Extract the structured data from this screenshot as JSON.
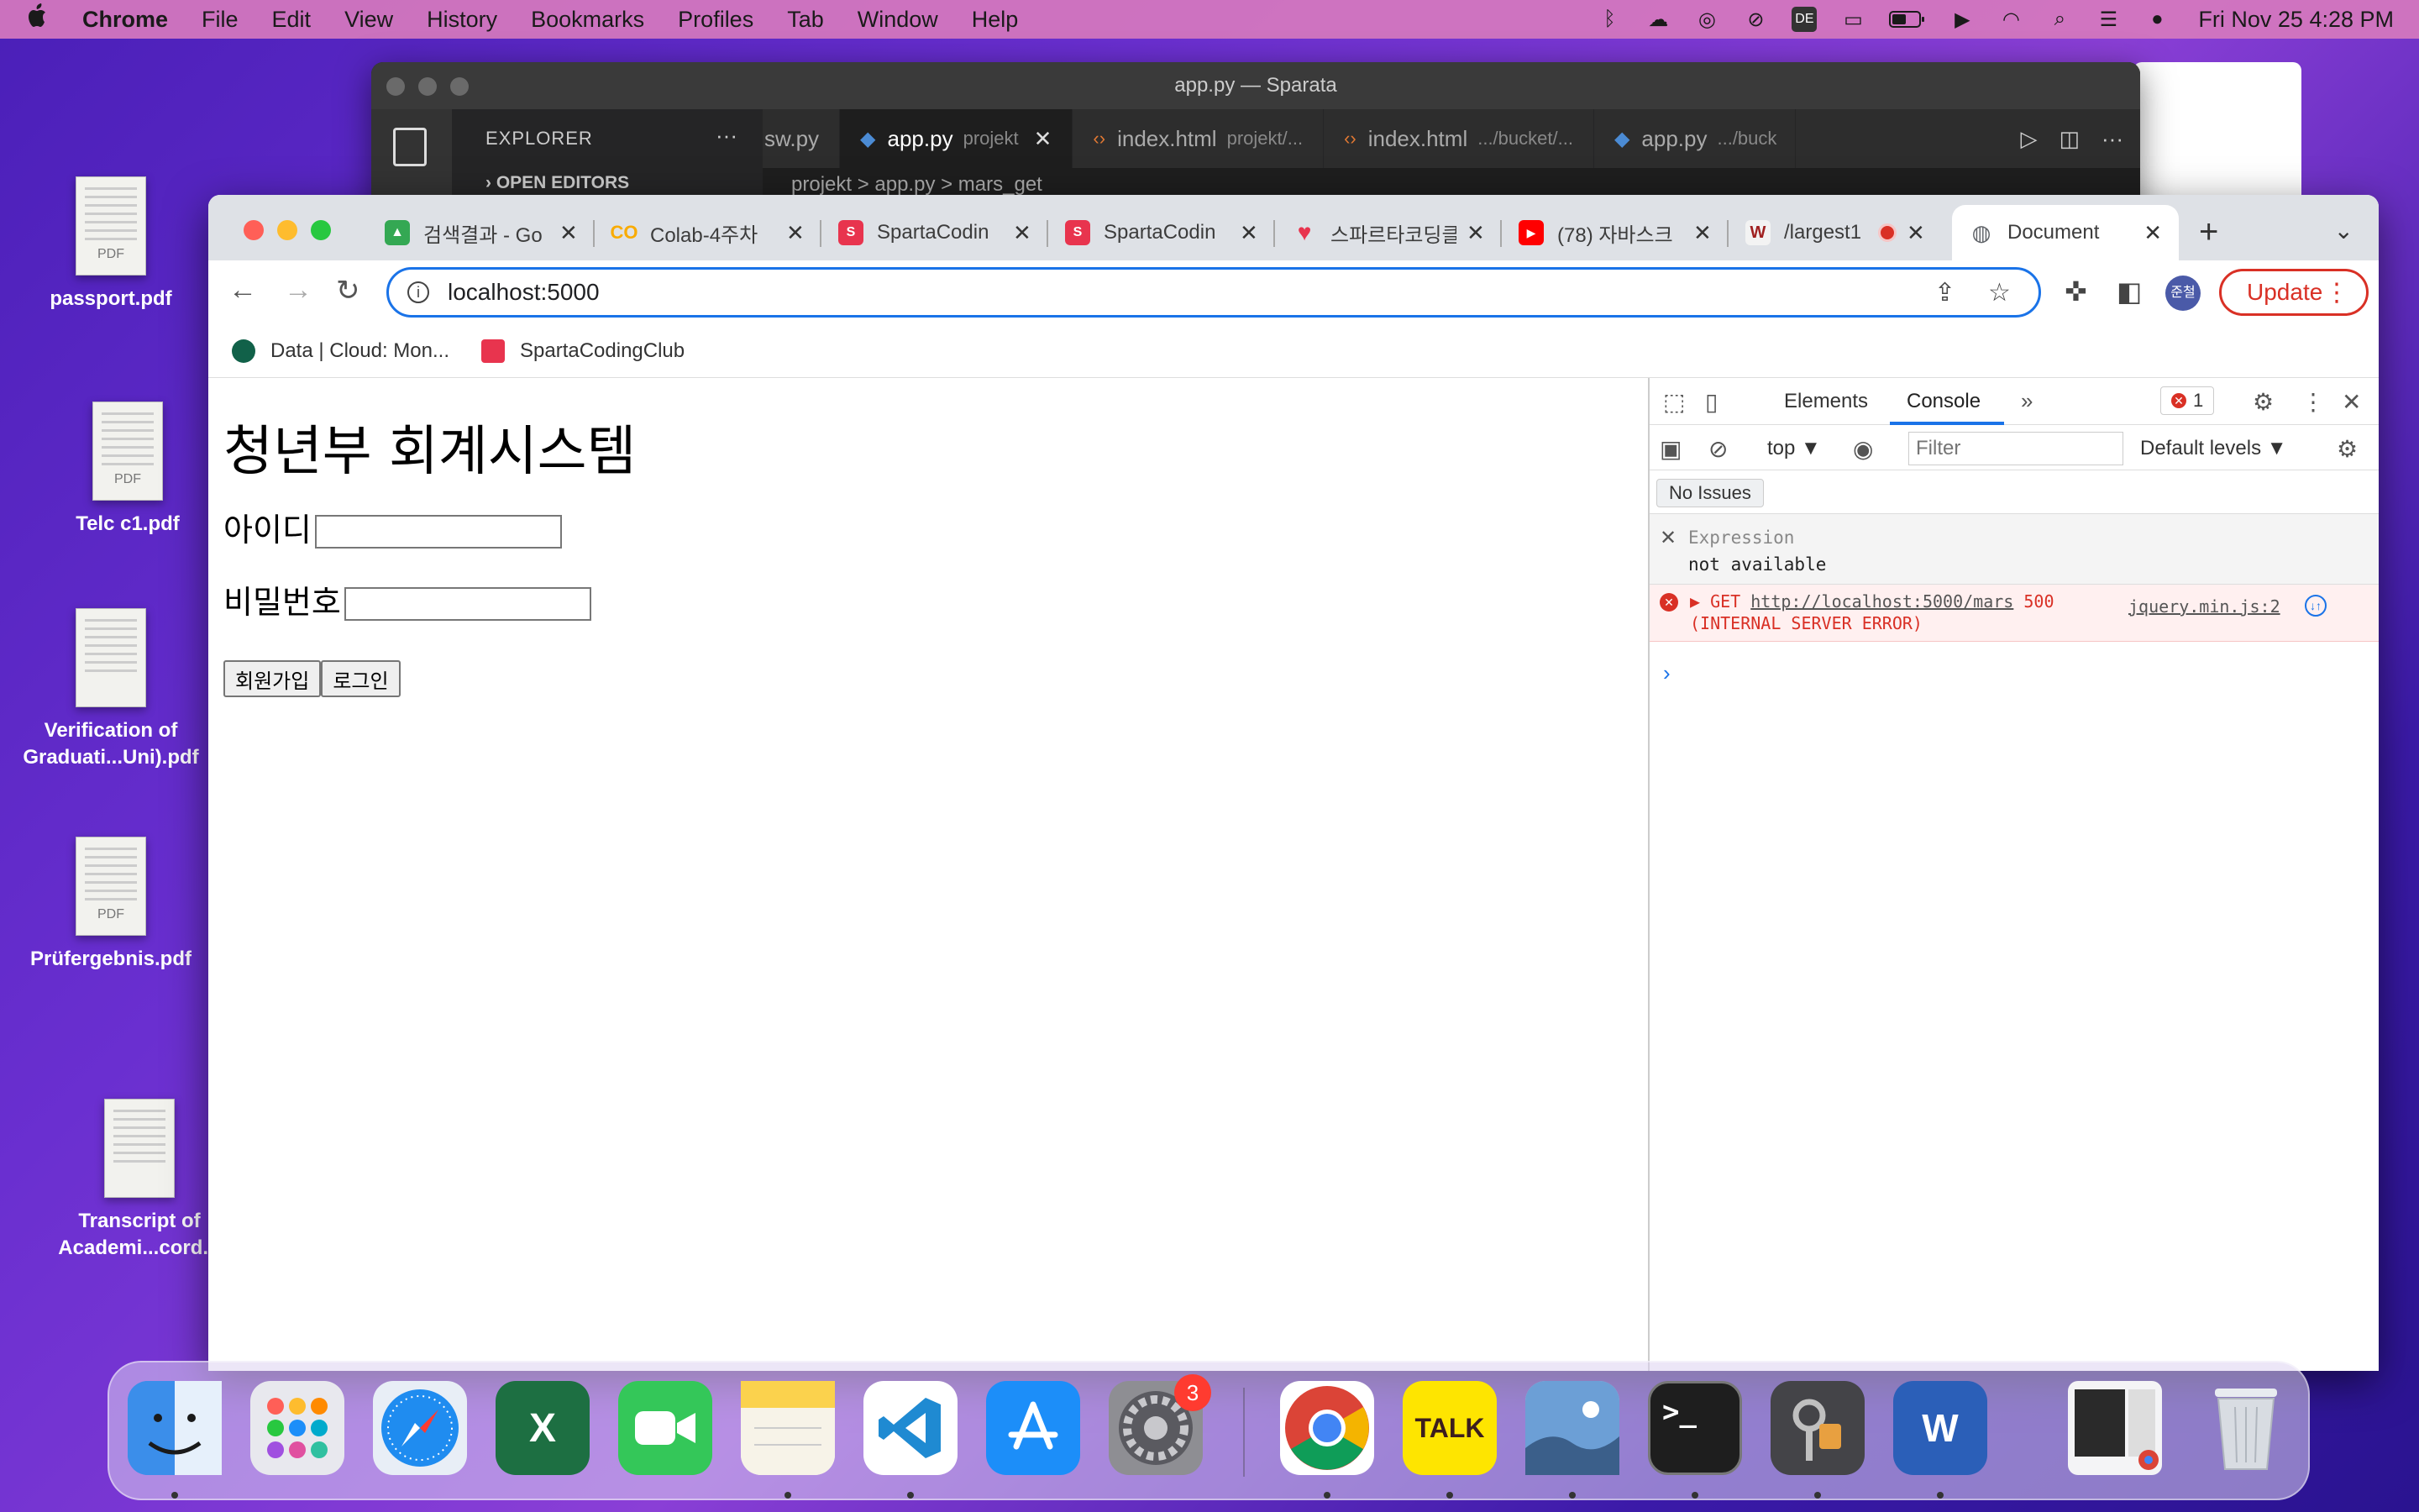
{
  "menubar": {
    "apple": "",
    "items": [
      "Chrome",
      "File",
      "Edit",
      "View",
      "History",
      "Bookmarks",
      "Profiles",
      "Tab",
      "Window",
      "Help"
    ],
    "status_icons": [
      "bluetooth-icon",
      "creative-cloud-icon",
      "airdrop-icon",
      "mute-icon",
      "keyboard-de-icon",
      "display-icon",
      "battery-icon",
      "play-icon",
      "wifi-icon",
      "spotlight-icon",
      "control-center-icon",
      "siri-icon"
    ],
    "keyboard_label": "DE",
    "clock": "Fri Nov 25  4:28 PM"
  },
  "desktop": {
    "files": [
      {
        "name": "passport.pdf",
        "tag": "PDF"
      },
      {
        "name": "Telc c1.pdf",
        "tag": "PDF"
      },
      {
        "name": "Verification of Graduati...Uni).pdf",
        "tag": ""
      },
      {
        "name": "Prüfergebnis.pdf",
        "tag": "PDF"
      },
      {
        "name": "Transcript of Academi...cord.p",
        "tag": ""
      }
    ]
  },
  "vscode": {
    "title": "app.py — Sparata",
    "explorer_title": "EXPLORER",
    "explorer_more": "···",
    "open_editors": "OPEN EDITORS",
    "tabs": [
      {
        "label": "sw.py",
        "sub": "",
        "kind": "py",
        "active": false
      },
      {
        "label": "app.py",
        "sub": "projekt",
        "kind": "py",
        "active": true
      },
      {
        "label": "index.html",
        "sub": "projekt/...",
        "kind": "html",
        "active": false
      },
      {
        "label": "index.html",
        "sub": ".../bucket/...",
        "kind": "html",
        "active": false
      },
      {
        "label": "app.py",
        "sub": ".../buck",
        "kind": "py",
        "active": false
      }
    ],
    "breadcrumb": "projekt  >  app.py  >  mars_get"
  },
  "chrome": {
    "tabs": [
      {
        "title": "검색결과 - Go",
        "icon": "google-drive-icon",
        "color": "#34a853"
      },
      {
        "title": "Colab-4주차",
        "icon": "colab-icon",
        "color": "#f9ab00"
      },
      {
        "title": "SpartaCodin",
        "icon": "sparta-icon",
        "color": "#e8344e"
      },
      {
        "title": "SpartaCodin",
        "icon": "sparta-icon",
        "color": "#e8344e"
      },
      {
        "title": "스파르타코딩클",
        "icon": "heart-icon",
        "color": "#e8344e"
      },
      {
        "title": "(78) 자바스크",
        "icon": "youtube-icon",
        "color": "#ff0000"
      },
      {
        "title": "/largest1",
        "icon": "wiki-icon",
        "color": "#a02020"
      },
      {
        "title": "Document",
        "icon": "globe-icon",
        "color": "#5f6368"
      }
    ],
    "new_tab": "+",
    "url": "localhost:5000",
    "update_label": "Update",
    "avatar_text": "준철",
    "bookmarks": [
      {
        "label": "Data | Cloud: Mon...",
        "color": "#116149"
      },
      {
        "label": "SpartaCodingClub",
        "color": "#e8344e"
      }
    ]
  },
  "page": {
    "heading": "청년부 회계시스템",
    "id_label": "아이디",
    "pw_label": "비밀번호",
    "signup_button": "회원가입",
    "login_button": "로그인"
  },
  "devtools": {
    "tabs": [
      "Elements",
      "Console"
    ],
    "active_tab": "Console",
    "more": "»",
    "error_count": "1",
    "context": "top ▼",
    "filter_placeholder": "Filter",
    "levels": "Default levels ▼",
    "issues": "No Issues",
    "expression_label": "Expression",
    "expression_value": "not available",
    "error": {
      "method": "▶ GET",
      "url": "http://localhost:5000/mars",
      "status": "500",
      "status_text": "(INTERNAL SERVER ERROR)",
      "source": "jquery.min.js:2"
    },
    "prompt": "›"
  },
  "dock": {
    "apps": [
      {
        "name": "finder",
        "label": "",
        "color": "#3b8eea"
      },
      {
        "name": "launchpad",
        "label": "",
        "color": "#e8e8ee"
      },
      {
        "name": "safari",
        "label": "",
        "color": "#1f8cf0"
      },
      {
        "name": "excel",
        "label": "X",
        "color": "#1d6f42"
      },
      {
        "name": "facetime",
        "label": "",
        "color": "#34c759"
      },
      {
        "name": "notes",
        "label": "",
        "color": "#f7f3e8"
      },
      {
        "name": "vscode",
        "label": "",
        "color": "#ffffff"
      },
      {
        "name": "app-store",
        "label": "",
        "color": "#1c8ef9"
      },
      {
        "name": "system-preferences",
        "label": "",
        "color": "#8e8e93",
        "badge": "3"
      },
      {
        "name": "chrome",
        "label": "",
        "color": "#ffffff"
      },
      {
        "name": "kakaotalk",
        "label": "TALK",
        "color": "#fee500"
      },
      {
        "name": "preview",
        "label": "",
        "color": "#b7c9e2"
      },
      {
        "name": "terminal",
        "label": ">_",
        "color": "#1e1e1e"
      },
      {
        "name": "keychain-access",
        "label": "",
        "color": "#444448"
      },
      {
        "name": "word",
        "label": "W",
        "color": "#2b5fb8"
      },
      {
        "name": "downloads",
        "label": "",
        "color": "#e9e9ee"
      },
      {
        "name": "trash",
        "label": "",
        "color": "#d8dce2"
      }
    ]
  }
}
